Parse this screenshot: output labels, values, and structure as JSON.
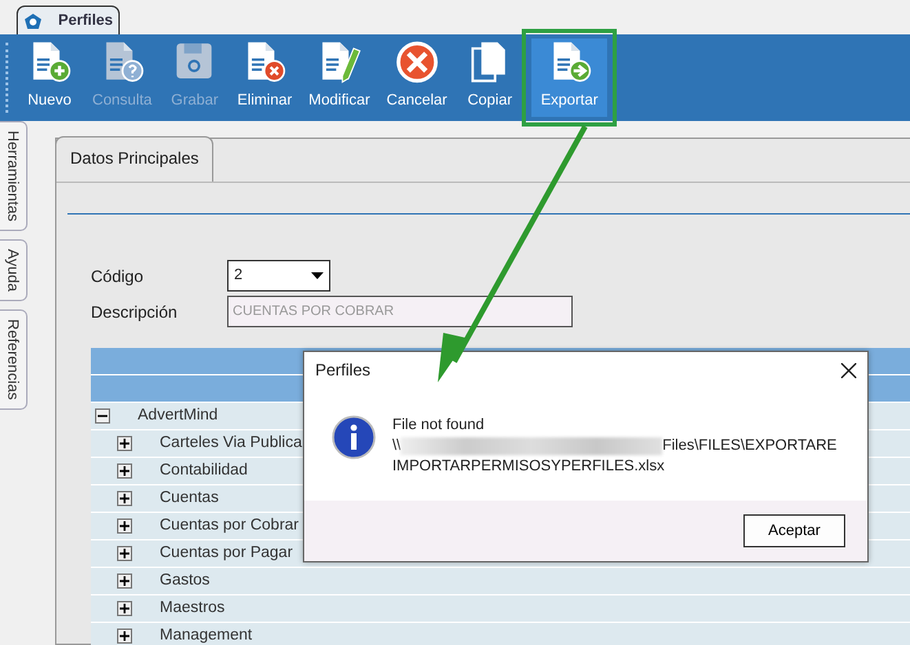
{
  "app_tab": {
    "title": "Perfiles",
    "selected": true
  },
  "toolbar": [
    {
      "label": "Nuevo",
      "kind": "new",
      "disabled": false,
      "highlighted": false
    },
    {
      "label": "Consulta",
      "kind": "query",
      "disabled": true,
      "highlighted": false
    },
    {
      "label": "Grabar",
      "kind": "save",
      "disabled": true,
      "highlighted": false
    },
    {
      "label": "Eliminar",
      "kind": "delete",
      "disabled": false,
      "highlighted": false
    },
    {
      "label": "Modificar",
      "kind": "edit",
      "disabled": false,
      "highlighted": false
    },
    {
      "label": "Cancelar",
      "kind": "cancel",
      "disabled": false,
      "highlighted": false
    },
    {
      "label": "Copiar",
      "kind": "copy",
      "disabled": false,
      "highlighted": false
    },
    {
      "label": "Exportar",
      "kind": "export",
      "disabled": false,
      "highlighted": true
    }
  ],
  "side_tabs": [
    {
      "label": "Herramientas"
    },
    {
      "label": "Ayuda"
    },
    {
      "label": "Referencias"
    }
  ],
  "form": {
    "tab": "Datos Principales",
    "fields": [
      {
        "label": "Código",
        "kind": "select",
        "value": "2"
      },
      {
        "label": "Descripción",
        "kind": "text",
        "value": "CUENTAS POR COBRAR",
        "disabled": true
      }
    ]
  },
  "tree": [
    {
      "label": "AdvertMind",
      "expanded": true,
      "children": [
        {
          "label": "Carteles Via Publica",
          "expanded": false
        },
        {
          "label": "Contabilidad",
          "expanded": false
        },
        {
          "label": "Cuentas",
          "expanded": false
        },
        {
          "label": "Cuentas por Cobrar",
          "expanded": false
        },
        {
          "label": "Cuentas por Pagar",
          "expanded": false
        },
        {
          "label": "Gastos",
          "expanded": false
        },
        {
          "label": "Maestros",
          "expanded": false
        },
        {
          "label": "Management",
          "expanded": false
        }
      ]
    }
  ],
  "dialog": {
    "title": "Perfiles",
    "heading": "File not found",
    "path_start": "\\\\",
    "path_end": "Files\\FILES\\EXPORTARE",
    "path_line2": "IMPORTARPERMISOSYPERFILES.xlsx",
    "button": "Aceptar"
  }
}
